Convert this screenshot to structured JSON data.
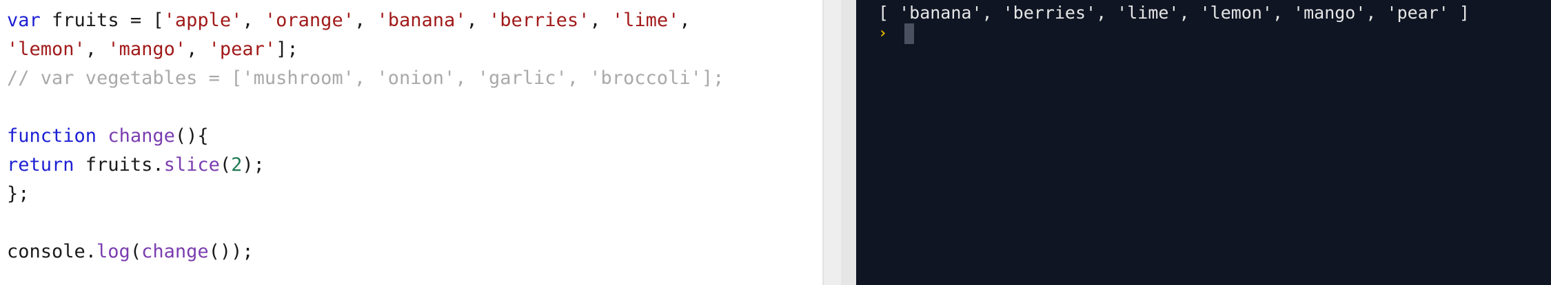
{
  "editor": {
    "lines": [
      {
        "kind": "code",
        "tokens": [
          {
            "t": "kw",
            "v": "var"
          },
          {
            "t": "pl",
            "v": " fruits = ["
          },
          {
            "t": "str",
            "v": "'apple'"
          },
          {
            "t": "pl",
            "v": ", "
          },
          {
            "t": "str",
            "v": "'orange'"
          },
          {
            "t": "pl",
            "v": ", "
          },
          {
            "t": "str",
            "v": "'banana'"
          },
          {
            "t": "pl",
            "v": ", "
          },
          {
            "t": "str",
            "v": "'berries'"
          },
          {
            "t": "pl",
            "v": ", "
          },
          {
            "t": "str",
            "v": "'lime'"
          },
          {
            "t": "pl",
            "v": ","
          }
        ]
      },
      {
        "kind": "code",
        "tokens": [
          {
            "t": "str",
            "v": "'lemon'"
          },
          {
            "t": "pl",
            "v": ", "
          },
          {
            "t": "str",
            "v": "'mango'"
          },
          {
            "t": "pl",
            "v": ", "
          },
          {
            "t": "str",
            "v": "'pear'"
          },
          {
            "t": "pl",
            "v": "];"
          }
        ]
      },
      {
        "kind": "comment",
        "tokens": [
          {
            "t": "com",
            "v": "// var vegetables = ['mushroom', 'onion', 'garlic', 'broccoli'];"
          }
        ]
      },
      {
        "kind": "blank",
        "tokens": []
      },
      {
        "kind": "code",
        "tokens": [
          {
            "t": "kw",
            "v": "function"
          },
          {
            "t": "pl",
            "v": " "
          },
          {
            "t": "fn",
            "v": "change"
          },
          {
            "t": "pl",
            "v": "(){"
          }
        ]
      },
      {
        "kind": "code",
        "tokens": [
          {
            "t": "kw",
            "v": "return"
          },
          {
            "t": "pl",
            "v": " fruits."
          },
          {
            "t": "fn",
            "v": "slice"
          },
          {
            "t": "pl",
            "v": "("
          },
          {
            "t": "num",
            "v": "2"
          },
          {
            "t": "pl",
            "v": ");"
          }
        ]
      },
      {
        "kind": "code",
        "tokens": [
          {
            "t": "pl",
            "v": "};"
          }
        ]
      },
      {
        "kind": "blank",
        "tokens": []
      },
      {
        "kind": "code",
        "tokens": [
          {
            "t": "pl",
            "v": "console."
          },
          {
            "t": "fn",
            "v": "log"
          },
          {
            "t": "pl",
            "v": "("
          },
          {
            "t": "fn",
            "v": "change"
          },
          {
            "t": "pl",
            "v": "());"
          }
        ]
      }
    ]
  },
  "console": {
    "output": "[ 'banana', 'berries', 'lime', 'lemon', 'mango', 'pear' ]",
    "prompt_icon": "prompt-chevron-icon"
  },
  "colors": {
    "keyword": "#1d20d3",
    "string": "#a11a1a",
    "function": "#7a3db0",
    "number": "#1f7a55",
    "comment": "#a9a9a9",
    "console_bg": "#0f1523",
    "prompt": "#e2b400"
  }
}
